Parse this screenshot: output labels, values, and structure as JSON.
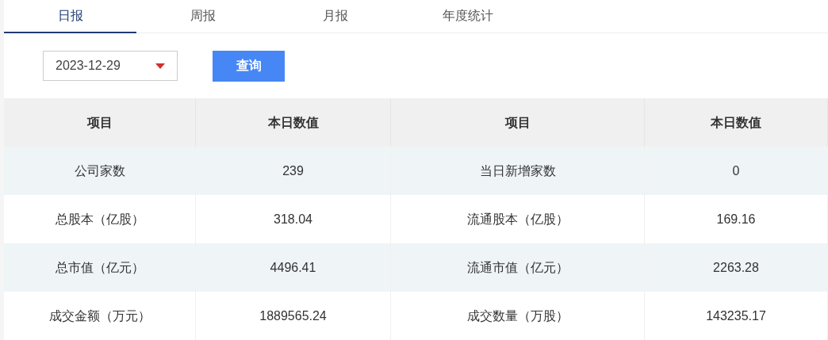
{
  "tabs": [
    {
      "label": "日报",
      "selected": true
    },
    {
      "label": "周报",
      "selected": false
    },
    {
      "label": "月报",
      "selected": false
    },
    {
      "label": "年度统计",
      "selected": false
    }
  ],
  "date_select": {
    "value": "2023-12-29"
  },
  "query_button": "查询",
  "table": {
    "columns": [
      "项目",
      "本日数值",
      "项目",
      "本日数值"
    ],
    "rows": [
      [
        "公司家数",
        "239",
        "当日新增家数",
        "0"
      ],
      [
        "总股本（亿股）",
        "318.04",
        "流通股本（亿股）",
        "169.16"
      ],
      [
        "总市值（亿元）",
        "4496.41",
        "流通市值（亿元）",
        "2263.28"
      ],
      [
        "成交金额（万元）",
        "1889565.24",
        "成交数量（万股）",
        "143235.17"
      ]
    ]
  }
}
